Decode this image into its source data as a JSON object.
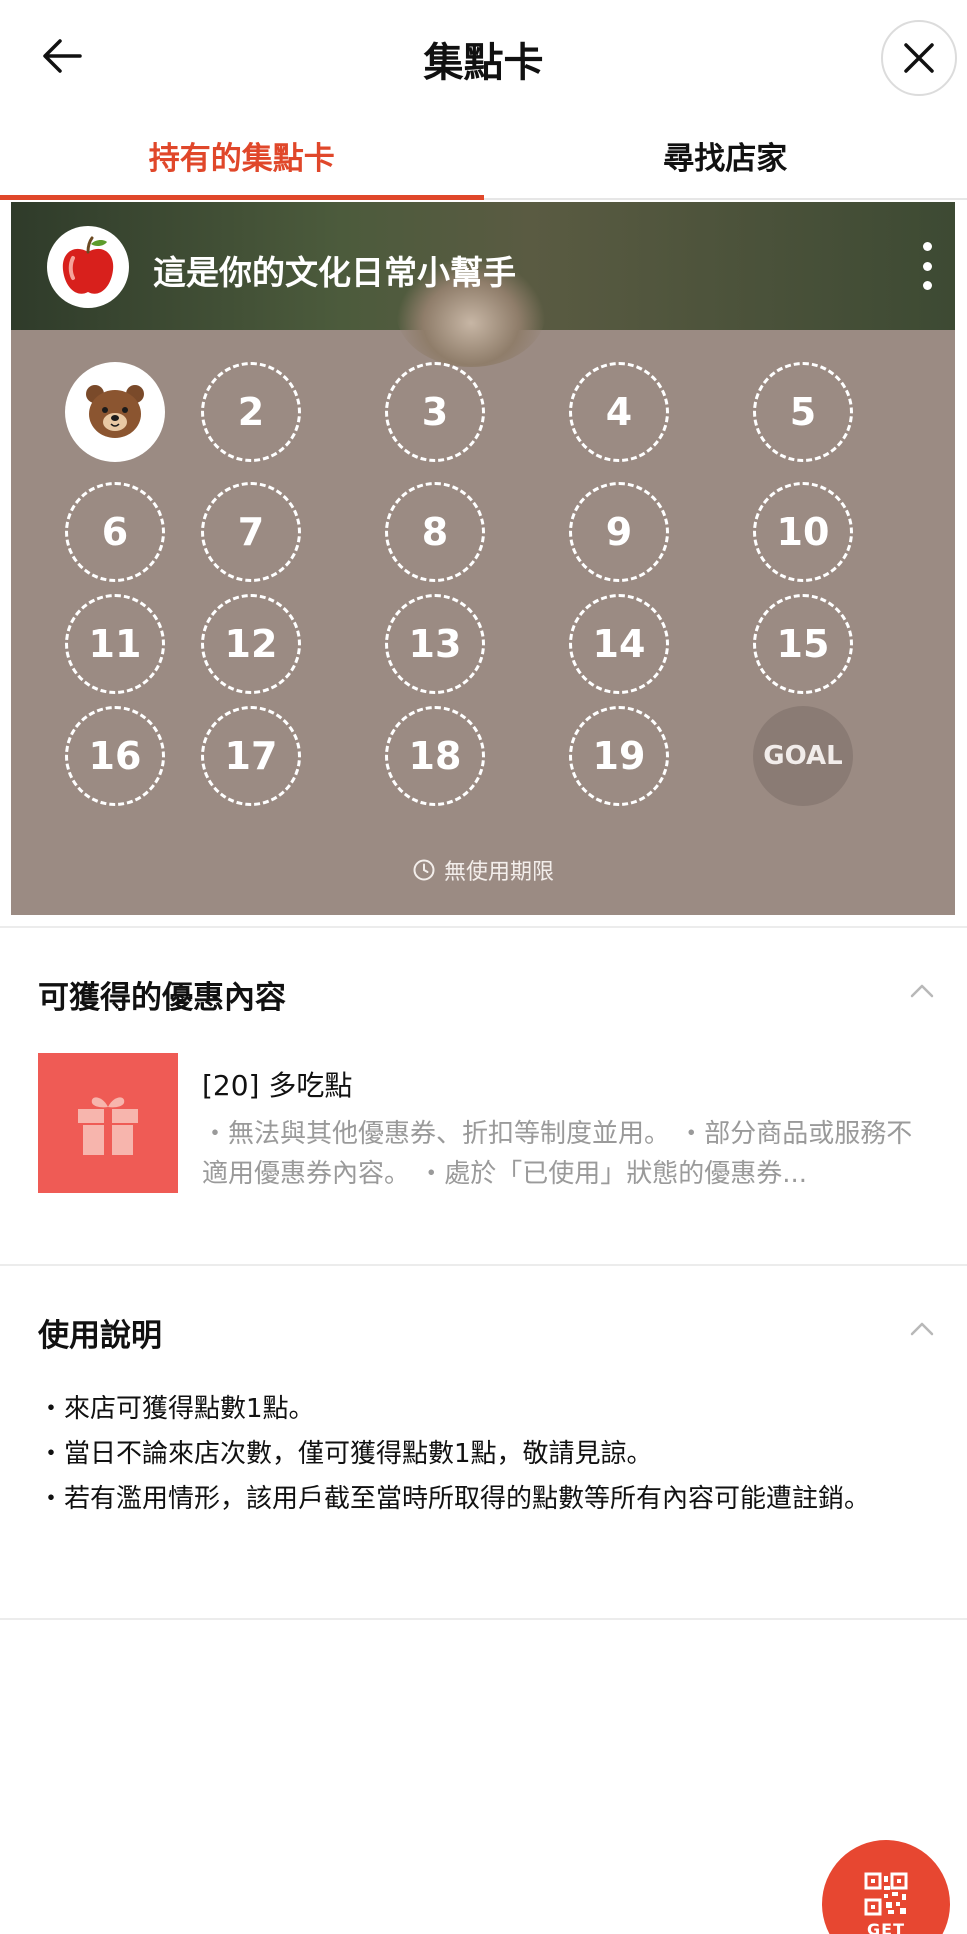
{
  "header": {
    "title": "集點卡"
  },
  "tabs": [
    {
      "label": "持有的集點卡",
      "active": true
    },
    {
      "label": "尋找店家",
      "active": false
    }
  ],
  "card": {
    "title": "這是你的文化日常小幫手",
    "avatar_icon": "apple-icon",
    "background_color": "#9b8b83",
    "stamps": [
      {
        "label": "",
        "filled": true,
        "icon": "bear-stamp-icon"
      },
      {
        "label": "2"
      },
      {
        "label": "3"
      },
      {
        "label": "4"
      },
      {
        "label": "5"
      },
      {
        "label": "6"
      },
      {
        "label": "7"
      },
      {
        "label": "8"
      },
      {
        "label": "9"
      },
      {
        "label": "10"
      },
      {
        "label": "11"
      },
      {
        "label": "12"
      },
      {
        "label": "13"
      },
      {
        "label": "14"
      },
      {
        "label": "15"
      },
      {
        "label": "16"
      },
      {
        "label": "17"
      },
      {
        "label": "18"
      },
      {
        "label": "19"
      },
      {
        "label": "GOAL",
        "goal": true
      }
    ],
    "stamps_collected": 1,
    "validity": "無使用期限"
  },
  "benefits": {
    "title": "可獲得的優惠內容",
    "item": {
      "icon": "gift-icon",
      "title": "[20] 多吃點",
      "description": "・無法與其他優惠券、折扣等制度並用。 ・部分商品或服務不適用優惠券內容。 ・處於「已使用」狀態的優惠券..."
    }
  },
  "usage": {
    "title": "使用說明",
    "lines": [
      "・來店可獲得點數1點。",
      "・當日不論來店次數，僅可獲得點數1點，敬請見諒。",
      "・若有濫用情形，該用戶截至當時所取得的點數等所有內容可能遭註銷。"
    ]
  },
  "fab": {
    "label": "GET",
    "icon": "qr-code-icon",
    "color": "#e74731"
  },
  "colors": {
    "accent": "#e0472a",
    "benefit_icon_bg": "#ef5b55"
  }
}
